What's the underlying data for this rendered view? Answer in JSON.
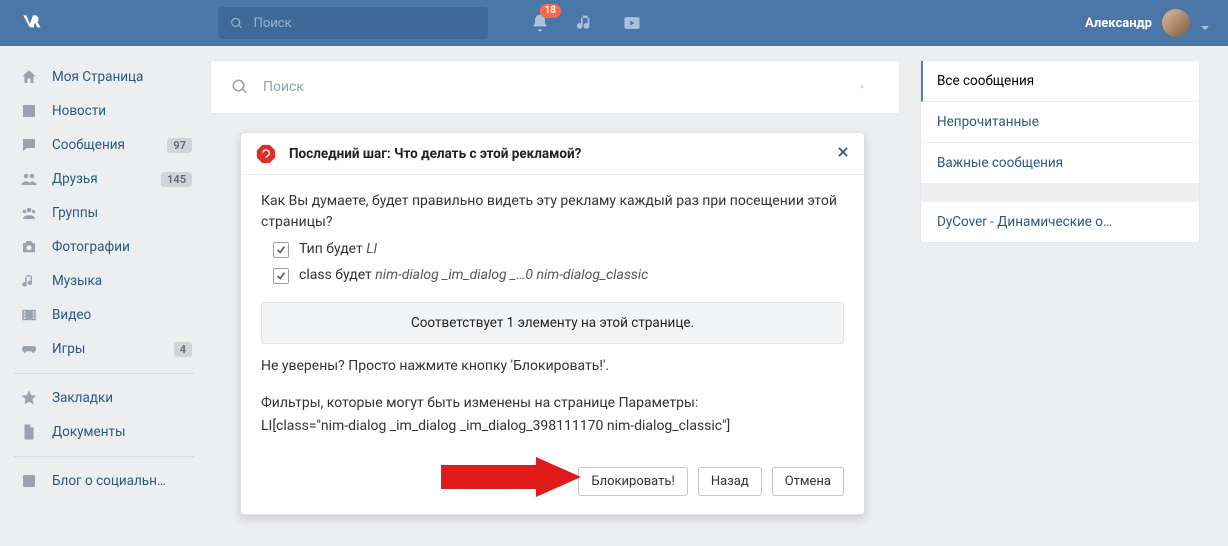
{
  "header": {
    "search_placeholder": "Поиск",
    "notif_count": "18",
    "user_name": "Александр"
  },
  "nav": {
    "items": [
      {
        "key": "my-page",
        "label": "Моя Страница",
        "icon": "home"
      },
      {
        "key": "news",
        "label": "Новости",
        "icon": "news"
      },
      {
        "key": "messages",
        "label": "Сообщения",
        "icon": "chat",
        "badge": "97"
      },
      {
        "key": "friends",
        "label": "Друзья",
        "icon": "friends",
        "badge": "145"
      },
      {
        "key": "groups",
        "label": "Группы",
        "icon": "groups"
      },
      {
        "key": "photos",
        "label": "Фотографии",
        "icon": "camera"
      },
      {
        "key": "music",
        "label": "Музыка",
        "icon": "music"
      },
      {
        "key": "videos",
        "label": "Видео",
        "icon": "video"
      },
      {
        "key": "games",
        "label": "Игры",
        "icon": "gamepad",
        "badge": "4"
      }
    ],
    "items2": [
      {
        "key": "bookmarks",
        "label": "Закладки",
        "icon": "star"
      },
      {
        "key": "docs",
        "label": "Документы",
        "icon": "doc"
      }
    ],
    "items3": [
      {
        "key": "blog",
        "label": "Блог о социальн…",
        "icon": "square"
      }
    ]
  },
  "main": {
    "search_placeholder": "Поиск"
  },
  "dialog": {
    "title": "Последний шаг: Что делать с этой рекламой?",
    "question": "Как Вы думаете, будет правильно видеть эту рекламу каждый раз при посещении этой страницы?",
    "check1_prefix": "Тип будет ",
    "check1_em": "LI",
    "check2_prefix": "class будет ",
    "check2_em": "nim-dialog _im_dialog _…0 nim-dialog_classic",
    "match_text": "Соответствует 1 элементу на этой странице.",
    "unsure": "Не уверены? Просто нажмите кнопку 'Блокировать!'.",
    "filters_line1": "Фильтры, которые могут быть изменены на странице Параметры:",
    "filters_line2": "LI[class=\"nim-dialog _im_dialog _im_dialog_398111170 nim-dialog_classic\"]",
    "btn_block": "Блокировать!",
    "btn_back": "Назад",
    "btn_cancel": "Отмена"
  },
  "right": {
    "all": "Все сообщения",
    "unread": "Непрочитанные",
    "important": "Важные сообщения",
    "dycover": "DyCover - Динамические о…"
  }
}
